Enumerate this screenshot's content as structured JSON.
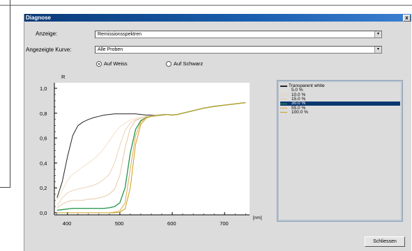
{
  "dialog": {
    "title": "Diagnose",
    "close_glyph": "x"
  },
  "controls": {
    "anzeige_label": "Anzeige:",
    "anzeige_value": "Remissionsspektren",
    "kurve_label": "Angezeigte Kurve:",
    "kurve_value": "Alle Proben",
    "dropdown_glyph": "▾",
    "radio_weiss": "Auf Weiss",
    "radio_schwarz": "Auf Schwarz",
    "radio_selected": "weiss"
  },
  "legend": {
    "items": [
      {
        "label": "Transparent white",
        "color": "#222222",
        "selected": false
      },
      {
        "label": "5.0 %",
        "color": "#f2e2c8",
        "selected": false
      },
      {
        "label": "10.0 %",
        "color": "#ead3b4",
        "selected": false
      },
      {
        "label": "15.0 %",
        "color": "#e4c8a6",
        "selected": false
      },
      {
        "label": "30.0 %",
        "color": "#2e9a55",
        "selected": true
      },
      {
        "label": "55.0 %",
        "color": "#e2a84a",
        "selected": false
      },
      {
        "label": "100.0 %",
        "color": "#c9a020",
        "selected": false
      }
    ]
  },
  "buttons": {
    "close_label": "Schliessen"
  },
  "chart_data": {
    "type": "line",
    "ylabel": "R",
    "xunit": "[nm]",
    "xlim": [
      375,
      745
    ],
    "ylim": [
      0.0,
      1.0
    ],
    "yticks": [
      "0,0",
      "0,2",
      "0,4",
      "0,6",
      "0,8",
      "1,0"
    ],
    "yvals": [
      0.0,
      0.2,
      0.4,
      0.6,
      0.8,
      1.0
    ],
    "xticks": [
      "400",
      "500",
      "600",
      "700"
    ],
    "xvals": [
      400,
      500,
      600,
      700
    ],
    "x": [
      380,
      390,
      400,
      410,
      420,
      430,
      440,
      450,
      460,
      470,
      480,
      490,
      500,
      510,
      520,
      530,
      540,
      550,
      560,
      570,
      580,
      590,
      600,
      610,
      620,
      640,
      660,
      680,
      700,
      720,
      740
    ],
    "series": [
      {
        "name": "Transparent white",
        "color": "#222222",
        "values": [
          0.12,
          0.25,
          0.45,
          0.62,
          0.7,
          0.73,
          0.75,
          0.765,
          0.775,
          0.785,
          0.79,
          0.795,
          0.795,
          0.795,
          0.795,
          0.795,
          0.79,
          0.785,
          0.785,
          0.785,
          0.79,
          0.79,
          0.785,
          0.79,
          0.8,
          0.82,
          0.84,
          0.855,
          0.865,
          0.875,
          0.885
        ]
      },
      {
        "name": "5.0 %",
        "color": "#f2e2c8",
        "values": [
          0.1,
          0.18,
          0.26,
          0.31,
          0.34,
          0.37,
          0.4,
          0.43,
          0.47,
          0.52,
          0.58,
          0.64,
          0.69,
          0.72,
          0.745,
          0.76,
          0.77,
          0.775,
          0.78,
          0.785,
          0.79,
          0.79,
          0.785,
          0.79,
          0.8,
          0.82,
          0.84,
          0.855,
          0.865,
          0.875,
          0.885
        ]
      },
      {
        "name": "10.0 %",
        "color": "#ead3b4",
        "values": [
          0.06,
          0.12,
          0.16,
          0.18,
          0.19,
          0.2,
          0.21,
          0.22,
          0.24,
          0.27,
          0.31,
          0.4,
          0.54,
          0.66,
          0.72,
          0.75,
          0.76,
          0.77,
          0.775,
          0.78,
          0.785,
          0.79,
          0.785,
          0.79,
          0.8,
          0.82,
          0.84,
          0.855,
          0.865,
          0.875,
          0.885
        ]
      },
      {
        "name": "15.0 %",
        "color": "#e4c8a6",
        "values": [
          0.04,
          0.07,
          0.09,
          0.1,
          0.1,
          0.1,
          0.11,
          0.11,
          0.12,
          0.13,
          0.15,
          0.19,
          0.3,
          0.52,
          0.68,
          0.74,
          0.76,
          0.77,
          0.775,
          0.78,
          0.785,
          0.79,
          0.785,
          0.79,
          0.8,
          0.82,
          0.84,
          0.855,
          0.865,
          0.875,
          0.885
        ]
      },
      {
        "name": "30.0 %",
        "color": "#2e9a55",
        "values": [
          0.02,
          0.025,
          0.03,
          0.035,
          0.035,
          0.035,
          0.035,
          0.035,
          0.035,
          0.035,
          0.04,
          0.05,
          0.08,
          0.2,
          0.48,
          0.67,
          0.74,
          0.765,
          0.775,
          0.78,
          0.785,
          0.79,
          0.785,
          0.79,
          0.8,
          0.82,
          0.84,
          0.855,
          0.865,
          0.875,
          0.885
        ]
      },
      {
        "name": "55.0 %",
        "color": "#e2a84a",
        "values": [
          0.0,
          0.0,
          0.0,
          0.0,
          0.0,
          0.0,
          0.0,
          0.0,
          0.0,
          0.0,
          0.0,
          0.005,
          0.015,
          0.08,
          0.35,
          0.62,
          0.73,
          0.765,
          0.775,
          0.78,
          0.785,
          0.79,
          0.785,
          0.79,
          0.8,
          0.82,
          0.84,
          0.855,
          0.865,
          0.875,
          0.885
        ]
      },
      {
        "name": "100.0 %",
        "color": "#c9a020",
        "values": [
          0.0,
          0.0,
          0.0,
          0.0,
          0.0,
          0.0,
          0.0,
          0.0,
          0.0,
          0.0,
          0.0,
          0.0,
          0.005,
          0.03,
          0.2,
          0.55,
          0.71,
          0.76,
          0.775,
          0.78,
          0.785,
          0.79,
          0.785,
          0.79,
          0.8,
          0.82,
          0.84,
          0.855,
          0.865,
          0.875,
          0.885
        ]
      }
    ]
  }
}
